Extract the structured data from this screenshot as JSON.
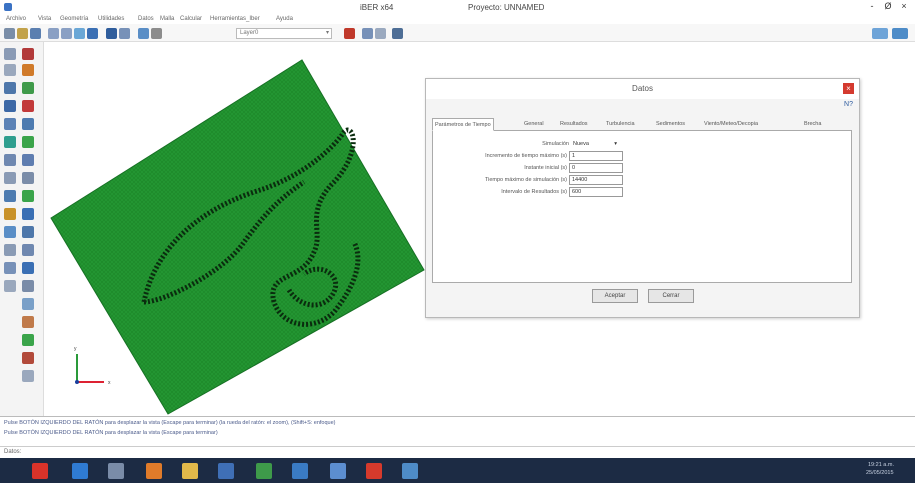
{
  "window": {
    "title": "iBER x64",
    "project": "Proyecto: UNNAMED",
    "minimize": "-",
    "maximize": "Ø",
    "close": "×"
  },
  "menu": [
    "Archivo",
    "Vista",
    "Geometría",
    "Utilidades",
    "Datos",
    "Malla",
    "Calcular",
    "Herramientas_Iber",
    "Ayuda"
  ],
  "toolbar": {
    "layer_value": "Layer0"
  },
  "dialog": {
    "title": "Datos",
    "close_label": "×",
    "help_icon_label": "N?",
    "tabs": [
      "Parámetros de Tiempo",
      "General",
      "Resultados",
      "Turbulencia",
      "Sedimentos",
      "Viento/Meteo/Decopia",
      "Brecha"
    ],
    "active_tab": 0,
    "simulation": {
      "label": "Simulación",
      "value": "Nueva"
    },
    "fields": [
      {
        "label": "Incremento de tiempo máximo (s)",
        "value": "1"
      },
      {
        "label": "Instante inicial (s)",
        "value": "0"
      },
      {
        "label": "Tiempo máximo de simulación (s)",
        "value": "14400"
      },
      {
        "label": "Intervalo de Resultados (s)",
        "value": "600"
      }
    ],
    "accept_label": "Aceptar",
    "close_button_label": "Cerrar"
  },
  "messages": [
    "Pulse BOTÓN IZQUIERDO DEL RATÓN para desplazar la vista (Escape para terminar) (la rueda del ratón: el zoom), (Shift+S: enfoque)",
    "Pulse BOTÓN IZQUIERDO DEL RATÓN para desplazar la vista (Escape para terminar)"
  ],
  "command_label": "Datos:",
  "tray": {
    "time": "19:21 a.m.",
    "date": "25/05/2015"
  },
  "colors": {
    "mesh_green": "#1f8c2c",
    "mesh_dark": "#0a2c0e",
    "taskbar": "#1c2b44",
    "close_red": "#d43a2f"
  }
}
